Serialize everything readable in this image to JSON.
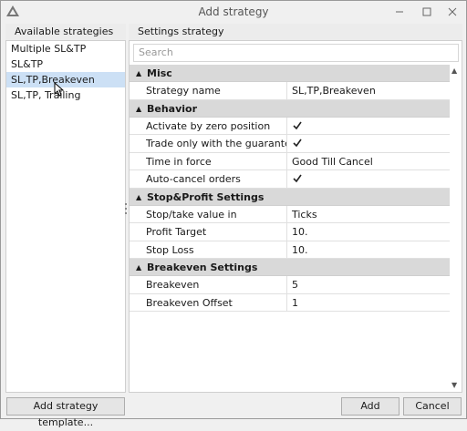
{
  "window": {
    "title": "Add strategy"
  },
  "left": {
    "header": "Available strategies",
    "items": [
      {
        "label": "Multiple SL&TP"
      },
      {
        "label": "SL&TP"
      },
      {
        "label": "SL,TP,Breakeven",
        "selected": true
      },
      {
        "label": "SL,TP, Trailing"
      }
    ],
    "add_template_label": "Add strategy template..."
  },
  "right": {
    "header": "Settings strategy",
    "search_placeholder": "Search",
    "categories": [
      {
        "label": "Misc",
        "rows": [
          {
            "name": "Strategy name",
            "value": "SL,TP,Breakeven"
          }
        ]
      },
      {
        "label": "Behavior",
        "rows": [
          {
            "name": "Activate by zero position",
            "checked": true
          },
          {
            "name": "Trade only with the guarante...",
            "checked": true
          },
          {
            "name": "Time in force",
            "value": "Good Till Cancel"
          },
          {
            "name": "Auto-cancel orders",
            "checked": true
          }
        ]
      },
      {
        "label": "Stop&Profit Settings",
        "rows": [
          {
            "name": "Stop/take value in",
            "value": "Ticks"
          },
          {
            "name": "Profit Target",
            "value": "10."
          },
          {
            "name": "Stop Loss",
            "value": "10."
          }
        ]
      },
      {
        "label": "Breakeven Settings",
        "rows": [
          {
            "name": "Breakeven",
            "value": "5"
          },
          {
            "name": "Breakeven Offset",
            "value": "1"
          }
        ]
      }
    ]
  },
  "footer": {
    "add_label": "Add",
    "cancel_label": "Cancel"
  },
  "icons": {
    "app": "app-logo-icon",
    "minimize": "minimize-icon",
    "maximize": "maximize-icon",
    "close": "close-icon",
    "collapse": "collapse-arrow-icon",
    "check": "checkmark-icon",
    "cursor": "mouse-cursor-icon"
  },
  "colors": {
    "selection": "#cce0f5",
    "category_bg": "#d9d9d9",
    "window_bg": "#f0f0f0"
  }
}
